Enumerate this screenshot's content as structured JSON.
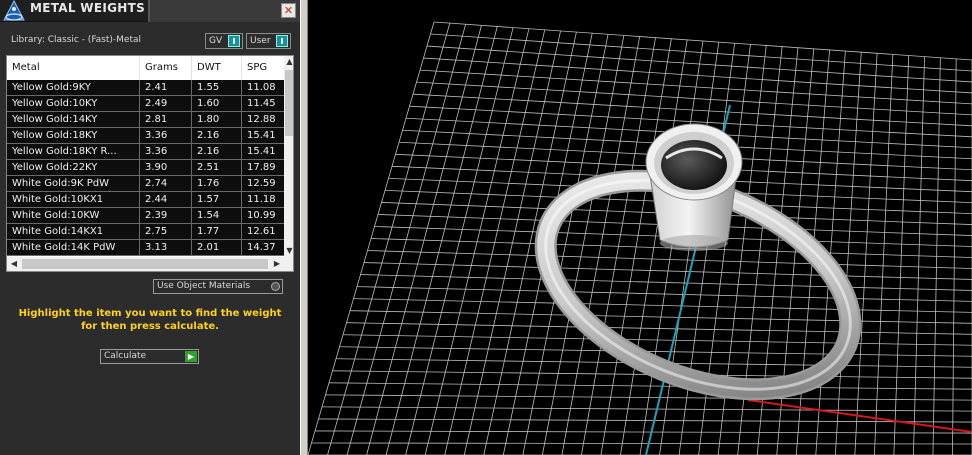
{
  "window": {
    "title": "METAL WEIGHTS",
    "close_glyph": "✕"
  },
  "library": {
    "label": "Library: Classic - (Fast)-Metal",
    "toggle_gv": "GV",
    "toggle_user": "User"
  },
  "table": {
    "columns": [
      "Metal",
      "Grams",
      "DWT",
      "SPG"
    ],
    "rows": [
      [
        "Yellow Gold:9KY",
        "2.41",
        "1.55",
        "11.08"
      ],
      [
        "Yellow Gold:10KY",
        "2.49",
        "1.60",
        "11.45"
      ],
      [
        "Yellow Gold:14KY",
        "2.81",
        "1.80",
        "12.88"
      ],
      [
        "Yellow Gold:18KY",
        "3.36",
        "2.16",
        "15.41"
      ],
      [
        "Yellow Gold:18KY R...",
        "3.36",
        "2.16",
        "15.41"
      ],
      [
        "Yellow Gold:22KY",
        "3.90",
        "2.51",
        "17.89"
      ],
      [
        "White Gold:9K PdW",
        "2.74",
        "1.76",
        "12.59"
      ],
      [
        "White Gold:10KX1",
        "2.44",
        "1.57",
        "11.18"
      ],
      [
        "White Gold:10KW",
        "2.39",
        "1.54",
        "10.99"
      ],
      [
        "White Gold:14KX1",
        "2.75",
        "1.77",
        "12.61"
      ],
      [
        "White Gold:14K PdW",
        "3.13",
        "2.01",
        "14.37"
      ]
    ]
  },
  "options": {
    "use_object_materials": "Use Object Materials"
  },
  "hint": {
    "line1": "Highlight the item you want to find the weight",
    "line2": "for then press calculate."
  },
  "calculate": {
    "label": "Calculate",
    "go_glyph": "▶"
  },
  "colors": {
    "hint_yellow": "#ffd21a",
    "grid": "#bdbdbd",
    "axis_y": "#1fa3b8",
    "axis_x": "#d11a1a",
    "panel_bg": "#2c2c2c"
  }
}
